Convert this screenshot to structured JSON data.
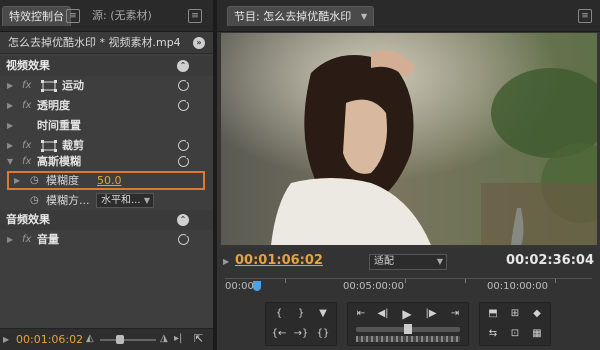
{
  "left_panel": {
    "tabs": [
      {
        "label": "特效控制台"
      },
      {
        "label": "源: (无素材)"
      }
    ],
    "clip_label": "怎么去掉优酷水印 * 视频素材.mp4",
    "video_effects_header": "视频效果",
    "video_effects": [
      {
        "name": "运动"
      },
      {
        "name": "透明度"
      },
      {
        "name": "时间重置"
      },
      {
        "name": "裁剪"
      },
      {
        "name": "高斯模糊"
      }
    ],
    "blur_amount_label": "模糊度",
    "blur_amount_value": "50.0",
    "blur_dimension_label": "模糊方...",
    "blur_dimension_value": "水平和...",
    "audio_effects_header": "音频效果",
    "audio_effects": [
      {
        "name": "音量"
      }
    ],
    "bottom_timecode": "00:01:06:02"
  },
  "program_monitor": {
    "tab_label": "节目: 怎么去掉优酷水印",
    "current_time": "00:01:06:02",
    "fit_value": "适配",
    "duration": "00:02:36:04",
    "ruler_labels": [
      "00:00",
      "00:05:00:00",
      "00:10:00:00"
    ]
  },
  "colors": {
    "accent_orange": "#e6a23c",
    "highlight_border": "#e0782e",
    "playhead_blue": "#4aa3e6"
  }
}
